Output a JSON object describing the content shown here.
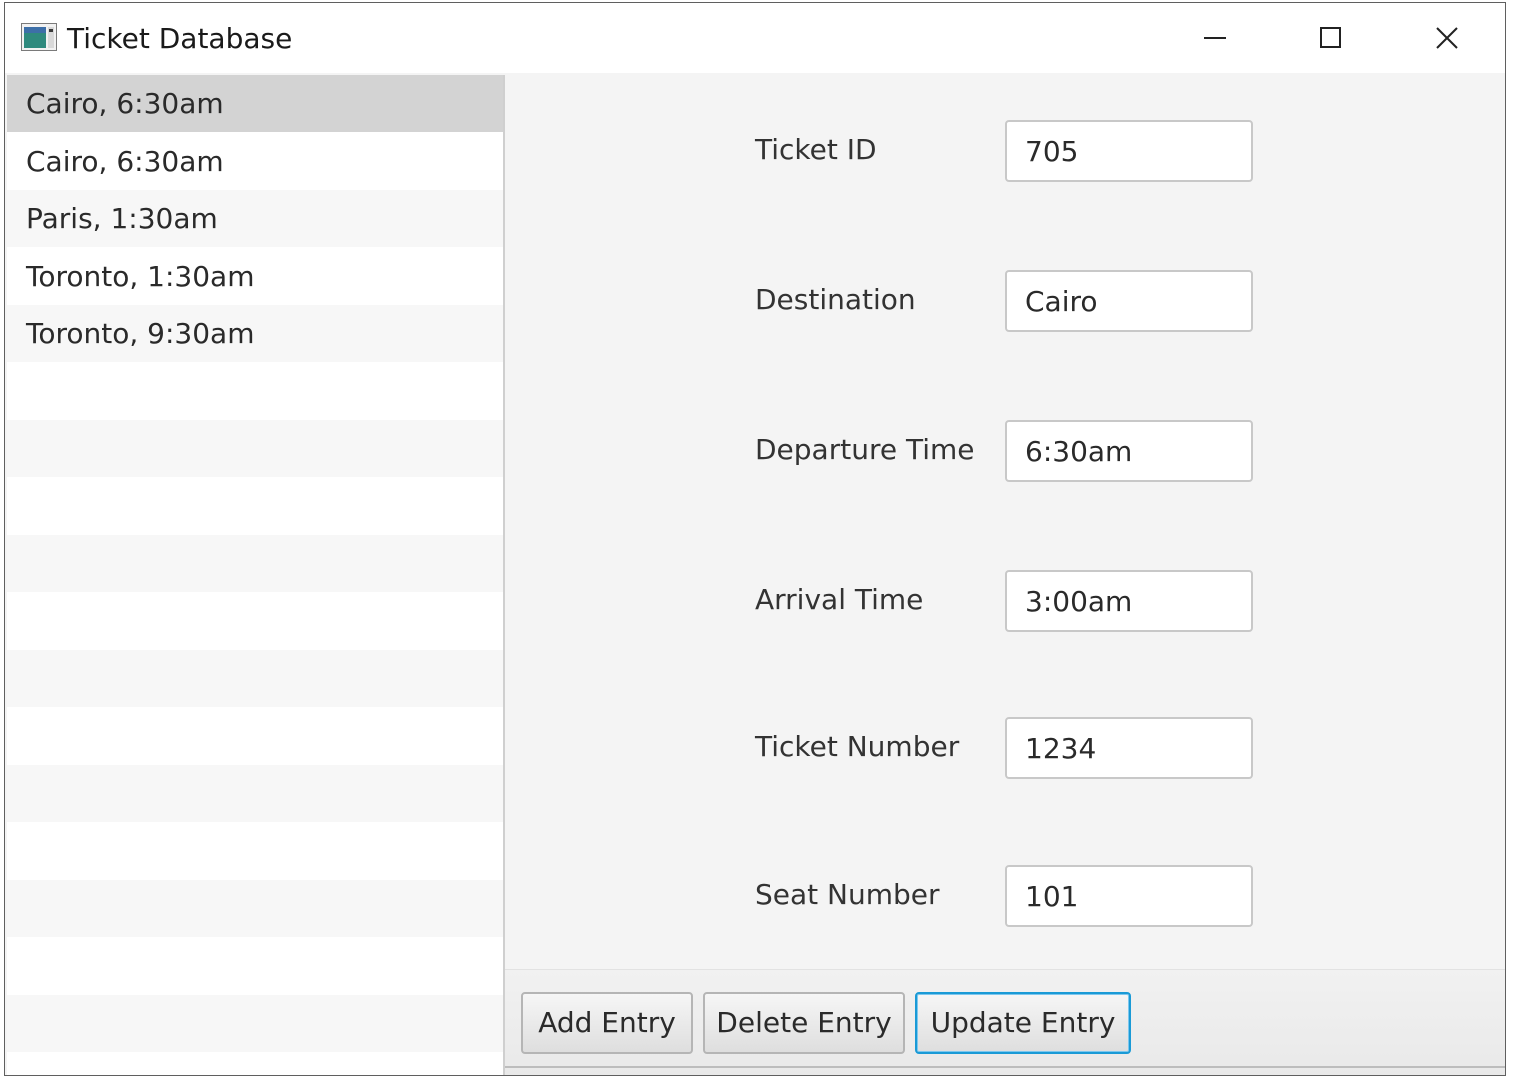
{
  "window": {
    "title": "Ticket Database",
    "icon": "app-window-icon",
    "controls": [
      "minimize-icon",
      "maximize-icon",
      "close-icon"
    ]
  },
  "list": {
    "items": [
      {
        "label": "Cairo, 6:30am",
        "selected": true
      },
      {
        "label": "Cairo, 6:30am",
        "selected": false
      },
      {
        "label": "Paris, 1:30am",
        "selected": false
      },
      {
        "label": "Toronto, 1:30am",
        "selected": false
      },
      {
        "label": "Toronto, 9:30am",
        "selected": false
      }
    ]
  },
  "form": {
    "fields": [
      {
        "label": "Ticket ID",
        "value": "705"
      },
      {
        "label": "Destination",
        "value": "Cairo"
      },
      {
        "label": "Departure Time",
        "value": "6:30am"
      },
      {
        "label": "Arrival Time",
        "value": "3:00am"
      },
      {
        "label": "Ticket Number",
        "value": "1234"
      },
      {
        "label": "Seat Number",
        "value": "101"
      }
    ]
  },
  "actions": {
    "add_label": "Add Entry",
    "delete_label": "Delete Entry",
    "update_label": "Update Entry"
  },
  "colors": {
    "selection": "#d3d3d3",
    "focus_border": "#1a9ad6",
    "pane_background": "#f4f4f4"
  }
}
